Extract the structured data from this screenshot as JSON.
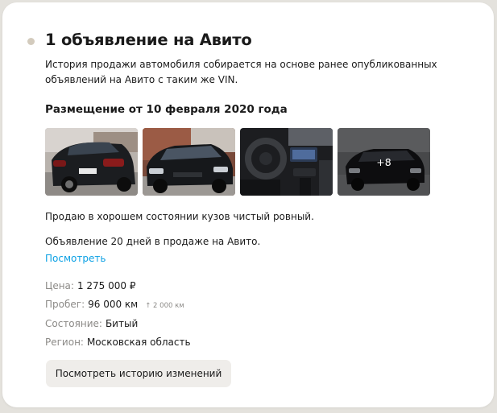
{
  "header": {
    "title": "1 объявление на Авито",
    "intro": "История продажи автомобиля собирается на основе ранее опубликованных объявлений на Авито с таким же VIN."
  },
  "listing": {
    "placement": "Размещение от 10 февраля 2020 года",
    "photos": [
      {
        "icon": "car-rear-photo"
      },
      {
        "icon": "car-front-photo"
      },
      {
        "icon": "car-interior-photo"
      },
      {
        "icon": "car-front-dark-photo",
        "more_label": "+8"
      }
    ],
    "description": "Продаю в хорошем состоянии кузов чистый ровный.",
    "duration": "Объявление 20 дней в продаже на Авито.",
    "view_link": "Посмотреть",
    "specs": {
      "price": {
        "label": "Цена:",
        "value": "1 275 000 ₽"
      },
      "mileage": {
        "label": "Пробег:",
        "value": "96 000 км",
        "delta": "↑ 2 000 км"
      },
      "condition": {
        "label": "Состояние:",
        "value": "Битый"
      },
      "region": {
        "label": "Регион:",
        "value": "Московская область"
      }
    },
    "history_button": "Посмотреть историю изменений"
  },
  "colors": {
    "accent_link": "#0aa0e4",
    "bullet": "#d3cbbd",
    "muted_text": "#8c8a87",
    "button_bg": "#efedea"
  }
}
